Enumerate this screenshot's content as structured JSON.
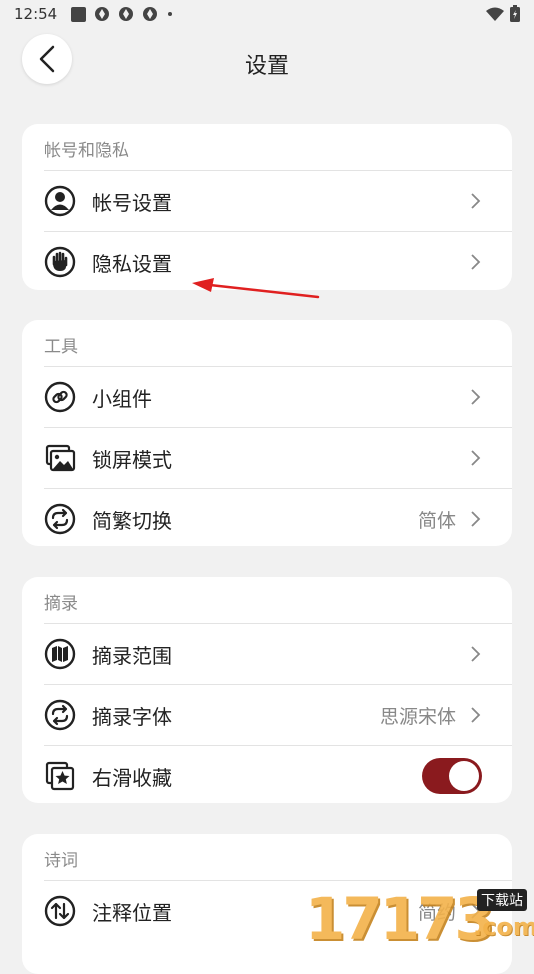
{
  "status_bar": {
    "time": "12:54"
  },
  "header": {
    "title": "设置"
  },
  "sections": [
    {
      "title": "帐号和隐私",
      "items": [
        {
          "label": "帐号设置",
          "icon": "account-icon",
          "value": ""
        },
        {
          "label": "隐私设置",
          "icon": "privacy-hand-icon",
          "value": ""
        }
      ]
    },
    {
      "title": "工具",
      "items": [
        {
          "label": "小组件",
          "icon": "widget-link-icon",
          "value": ""
        },
        {
          "label": "锁屏模式",
          "icon": "lockscreen-image-icon",
          "value": ""
        },
        {
          "label": "简繁切换",
          "icon": "convert-icon",
          "value": "简体"
        }
      ]
    },
    {
      "title": "摘录",
      "items": [
        {
          "label": "摘录范围",
          "icon": "range-book-icon",
          "value": ""
        },
        {
          "label": "摘录字体",
          "icon": "font-convert-icon",
          "value": "思源宋体"
        },
        {
          "label": "右滑收藏",
          "icon": "favorite-star-icon",
          "toggle_on": true
        }
      ]
    },
    {
      "title": "诗词",
      "items": [
        {
          "label": "注释位置",
          "icon": "position-swap-icon",
          "value": "简约"
        }
      ]
    }
  ],
  "colors": {
    "accent": "#8a1a1e",
    "annotation_arrow": "#e02020"
  },
  "watermark": {
    "text": "17173",
    "suffix": ".com",
    "tag": "下载站"
  }
}
